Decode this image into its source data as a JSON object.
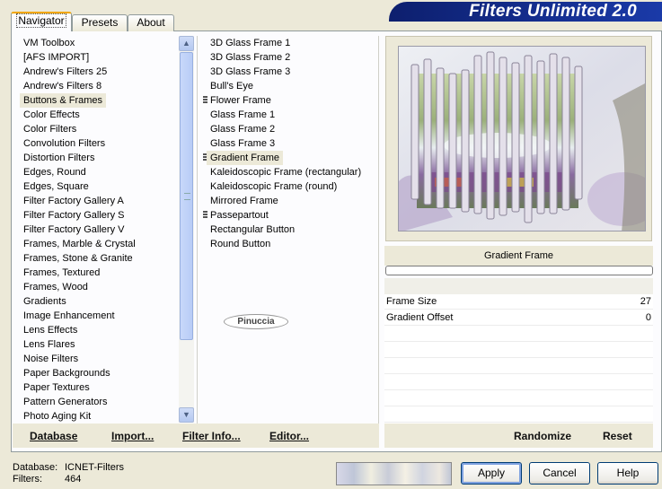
{
  "tabs": [
    "Navigator",
    "Presets",
    "About"
  ],
  "app_title": "Filters Unlimited 2.0",
  "categories": [
    "VM Toolbox",
    "[AFS IMPORT]",
    "Andrew's Filters 25",
    "Andrew's Filters 8",
    "Buttons & Frames",
    "Color Effects",
    "Color Filters",
    "Convolution Filters",
    "Distortion Filters",
    "Edges, Round",
    "Edges, Square",
    "Filter Factory Gallery A",
    "Filter Factory Gallery S",
    "Filter Factory Gallery V",
    "Frames, Marble & Crystal",
    "Frames, Stone & Granite",
    "Frames, Textured",
    "Frames, Wood",
    "Gradients",
    "Image Enhancement",
    "Lens Effects",
    "Lens Flares",
    "Noise Filters",
    "Paper Backgrounds",
    "Paper Textures",
    "Pattern Generators",
    "Photo Aging Kit"
  ],
  "selected_category": "Buttons & Frames",
  "filters": [
    {
      "name": "3D Glass Frame 1",
      "marked": false
    },
    {
      "name": "3D Glass Frame 2",
      "marked": false
    },
    {
      "name": "3D Glass Frame 3",
      "marked": false
    },
    {
      "name": "Bull's Eye",
      "marked": false
    },
    {
      "name": "Flower Frame",
      "marked": true
    },
    {
      "name": "Glass Frame 1",
      "marked": false
    },
    {
      "name": "Glass Frame 2",
      "marked": false
    },
    {
      "name": "Glass Frame 3",
      "marked": false
    },
    {
      "name": "Gradient Frame",
      "marked": true
    },
    {
      "name": "Kaleidoscopic Frame (rectangular)",
      "marked": false
    },
    {
      "name": "Kaleidoscopic Frame (round)",
      "marked": false
    },
    {
      "name": "Mirrored Frame",
      "marked": false
    },
    {
      "name": "Passepartout",
      "marked": true
    },
    {
      "name": "Rectangular Button",
      "marked": false
    },
    {
      "name": "Round Button",
      "marked": false
    }
  ],
  "selected_filter": "Gradient Frame",
  "watermark": "Pinuccia",
  "preview": {
    "filter_name": "Gradient Frame"
  },
  "params": [
    {
      "name": "Frame Size",
      "value": "27"
    },
    {
      "name": "Gradient Offset",
      "value": "0"
    }
  ],
  "toolbar": {
    "database": "Database",
    "import": "Import...",
    "filter_info": "Filter Info...",
    "editor": "Editor...",
    "randomize": "Randomize",
    "reset": "Reset"
  },
  "status": {
    "database_label": "Database:",
    "database_value": "ICNET-Filters",
    "filters_label": "Filters:",
    "filters_value": "464"
  },
  "buttons": {
    "apply": "Apply",
    "cancel": "Cancel",
    "help": "Help"
  },
  "colors": {
    "banner": "#0d1f6e",
    "window_bg": "#ece9d8",
    "tab_highlight": "#f1a600"
  }
}
